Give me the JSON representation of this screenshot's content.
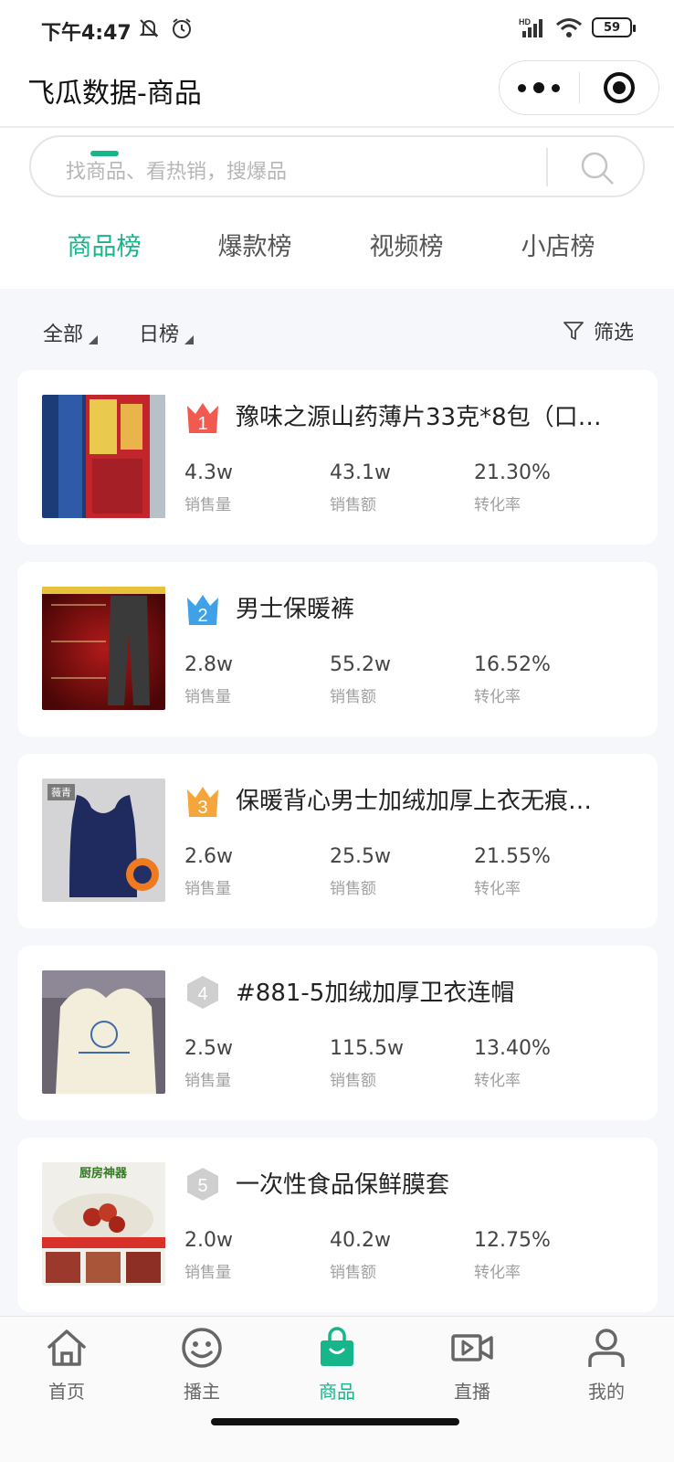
{
  "status_bar": {
    "time": "下午4:47",
    "battery": "59",
    "network": "HD"
  },
  "header": {
    "title": "飞瓜数据-商品"
  },
  "search": {
    "placeholder": "找商品、看热销，搜爆品"
  },
  "tabs": [
    {
      "label": "商品榜",
      "active": true
    },
    {
      "label": "爆款榜",
      "active": false
    },
    {
      "label": "视频榜",
      "active": false
    },
    {
      "label": "小店榜",
      "active": false
    }
  ],
  "filters": {
    "category": "全部",
    "period": "日榜",
    "filter_label": "筛选"
  },
  "metric_labels": {
    "sales_volume": "销售量",
    "sales_amount": "销售额",
    "conversion": "转化率"
  },
  "products": [
    {
      "rank": "1",
      "title": "豫味之源山药薄片33克*8包（口…",
      "sales_volume": "4.3w",
      "sales_amount": "43.1w",
      "conversion": "21.30%",
      "thumb_label": ""
    },
    {
      "rank": "2",
      "title": "男士保暖裤",
      "sales_volume": "2.8w",
      "sales_amount": "55.2w",
      "conversion": "16.52%",
      "thumb_label": ""
    },
    {
      "rank": "3",
      "title": "保暖背心男士加绒加厚上衣无痕…",
      "sales_volume": "2.6w",
      "sales_amount": "25.5w",
      "conversion": "21.55%",
      "thumb_label": "薇青"
    },
    {
      "rank": "4",
      "title": "#881-5加绒加厚卫衣连帽",
      "sales_volume": "2.5w",
      "sales_amount": "115.5w",
      "conversion": "13.40%",
      "thumb_label": ""
    },
    {
      "rank": "5",
      "title": "一次性食品保鲜膜套",
      "sales_volume": "2.0w",
      "sales_amount": "40.2w",
      "conversion": "12.75%",
      "thumb_label": "厨房神器"
    }
  ],
  "bottom_nav": [
    {
      "label": "首页",
      "icon": "home-icon",
      "active": false
    },
    {
      "label": "播主",
      "icon": "smiley-icon",
      "active": false
    },
    {
      "label": "商品",
      "icon": "shopping-bag-icon",
      "active": true
    },
    {
      "label": "直播",
      "icon": "video-icon",
      "active": false
    },
    {
      "label": "我的",
      "icon": "user-icon",
      "active": false
    }
  ],
  "colors": {
    "accent": "#17b58a",
    "rank1": "#f05a4f",
    "rank2": "#3fa2e8",
    "rank3": "#f6a53a",
    "rank_other": "#c8c8c8"
  }
}
